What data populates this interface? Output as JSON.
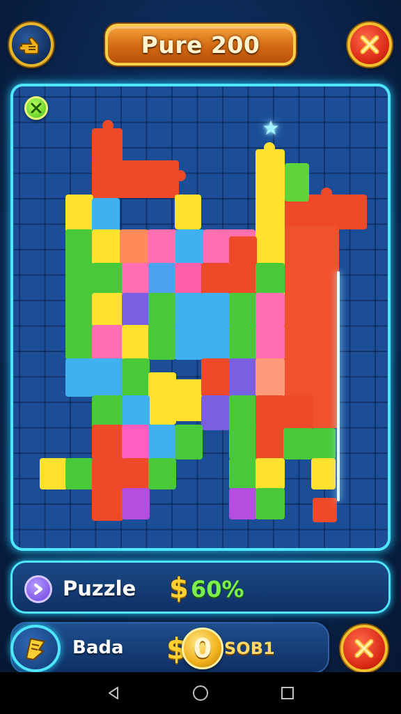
{
  "header": {
    "title": "Pure 200",
    "back_icon": "pointing-hand-icon",
    "close_icon": "close-x-icon"
  },
  "board": {
    "hint_icon": "shuffle-icon",
    "frame_color": "#4fe6ff",
    "background_color": "#1c4e98"
  },
  "puzzle_panel": {
    "icon": "chevron-badge-icon",
    "label": "Puzzle",
    "currency_symbol": "$",
    "value": "60%"
  },
  "bada_panel": {
    "icon": "wing-badge-icon",
    "label": "Bada",
    "currency_symbol": "$",
    "coin_value": "0",
    "code": "SOB1"
  },
  "system_nav": {
    "back": "back-triangle-icon",
    "home": "home-circle-icon",
    "recents": "recents-square-icon"
  }
}
